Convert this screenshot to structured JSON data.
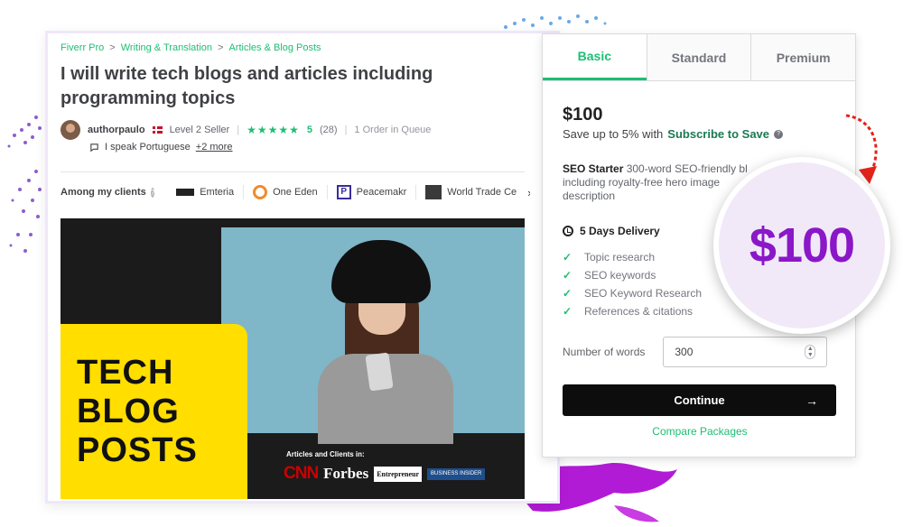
{
  "breadcrumb": {
    "items": [
      "Fiverr Pro",
      "Writing & Translation",
      "Articles & Blog Posts"
    ],
    "separator": ">"
  },
  "gig": {
    "title": "I will write tech blogs and articles including programming topics"
  },
  "seller": {
    "name": "authorpaulo",
    "level": "Level 2 Seller",
    "stars": "★★★★★",
    "rating": "5",
    "reviews": "(28)",
    "queue": "1 Order in Queue",
    "language": "I speak Portuguese",
    "more_languages": "+2 more"
  },
  "clients": {
    "label": "Among my clients",
    "items": [
      "Emteria",
      "One Eden",
      "Peacemakr",
      "World Trade Ce"
    ]
  },
  "hero": {
    "headline": [
      "TECH",
      "BLOG",
      "POSTS"
    ],
    "press_label": "Articles and Clients in:",
    "press": [
      "CNN",
      "Forbes",
      "Entrepreneur",
      "BUSINESS INSIDER"
    ]
  },
  "packages": {
    "tabs": [
      "Basic",
      "Standard",
      "Premium"
    ],
    "active_tab": "Basic",
    "price": "$100",
    "save_text": "Save up to 5% with",
    "save_link": "Subscribe to Save",
    "name": "SEO Starter",
    "description": "300-word SEO-friendly bl... including royalty-free hero image ... description",
    "description_parts": {
      "lead": "300-word SEO-friendly bl",
      "line2": "including royalty-free hero image",
      "line3": "description"
    },
    "delivery": "5 Days Delivery",
    "features": [
      "Topic research",
      "SEO keywords",
      "SEO Keyword Research",
      "References & citations"
    ],
    "words_label": "Number of words",
    "words_value": "300",
    "continue_label": "Continue",
    "compare_label": "Compare Packages"
  },
  "magnifier": {
    "price": "$100"
  },
  "colors": {
    "accent_green": "#1dbf73",
    "bubble_purple": "#8a17c8",
    "hero_yellow": "#ffde00"
  }
}
